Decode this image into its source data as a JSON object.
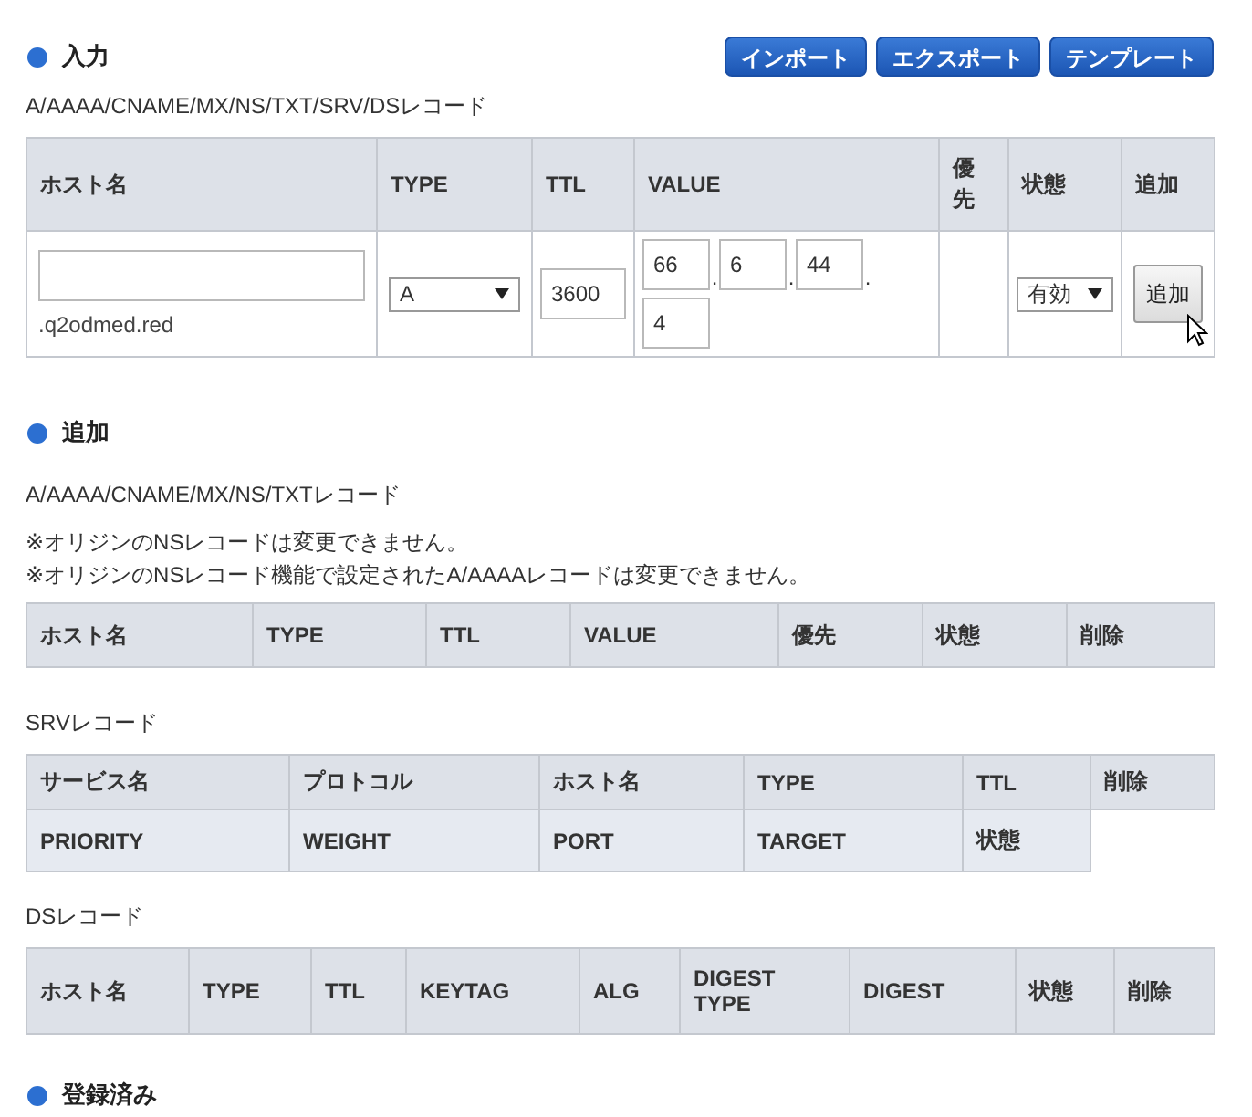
{
  "input_section": {
    "title": "入力",
    "buttons": [
      "インポート",
      "エクスポート",
      "テンプレート"
    ],
    "caption": "A/AAAA/CNAME/MX/NS/TXT/SRV/DSレコード",
    "columns": [
      "ホスト名",
      "TYPE",
      "TTL",
      "VALUE",
      "優先",
      "状態",
      "追加"
    ],
    "row": {
      "hostname_suffix": ".q2odmed.red",
      "type": "A",
      "ttl": "3600",
      "octets": [
        "66",
        "6",
        "44",
        "4"
      ],
      "octet_separator": ".",
      "status": "有効",
      "add_button": "追加"
    }
  },
  "add_section": {
    "title": "追加",
    "caption": "A/AAAA/CNAME/MX/NS/TXTレコード",
    "notes": [
      "※オリジンのNSレコードは変更できません。",
      "※オリジンのNSレコード機能で設定されたA/AAAAレコードは変更できません。"
    ],
    "columns": [
      "ホスト名",
      "TYPE",
      "TTL",
      "VALUE",
      "優先",
      "状態",
      "削除"
    ]
  },
  "srv": {
    "caption": "SRVレコード",
    "header_rows": [
      [
        "サービス名",
        "プロトコル",
        "ホスト名",
        "TYPE",
        "TTL",
        "削除"
      ],
      [
        "PRIORITY",
        "WEIGHT",
        "PORT",
        "TARGET",
        "状態"
      ]
    ]
  },
  "ds": {
    "caption": "DSレコード",
    "columns": [
      "ホスト名",
      "TYPE",
      "TTL",
      "KEYTAG",
      "ALG",
      "DIGEST TYPE",
      "DIGEST",
      "状態",
      "削除"
    ]
  },
  "registered_section": {
    "title": "登録済み"
  }
}
